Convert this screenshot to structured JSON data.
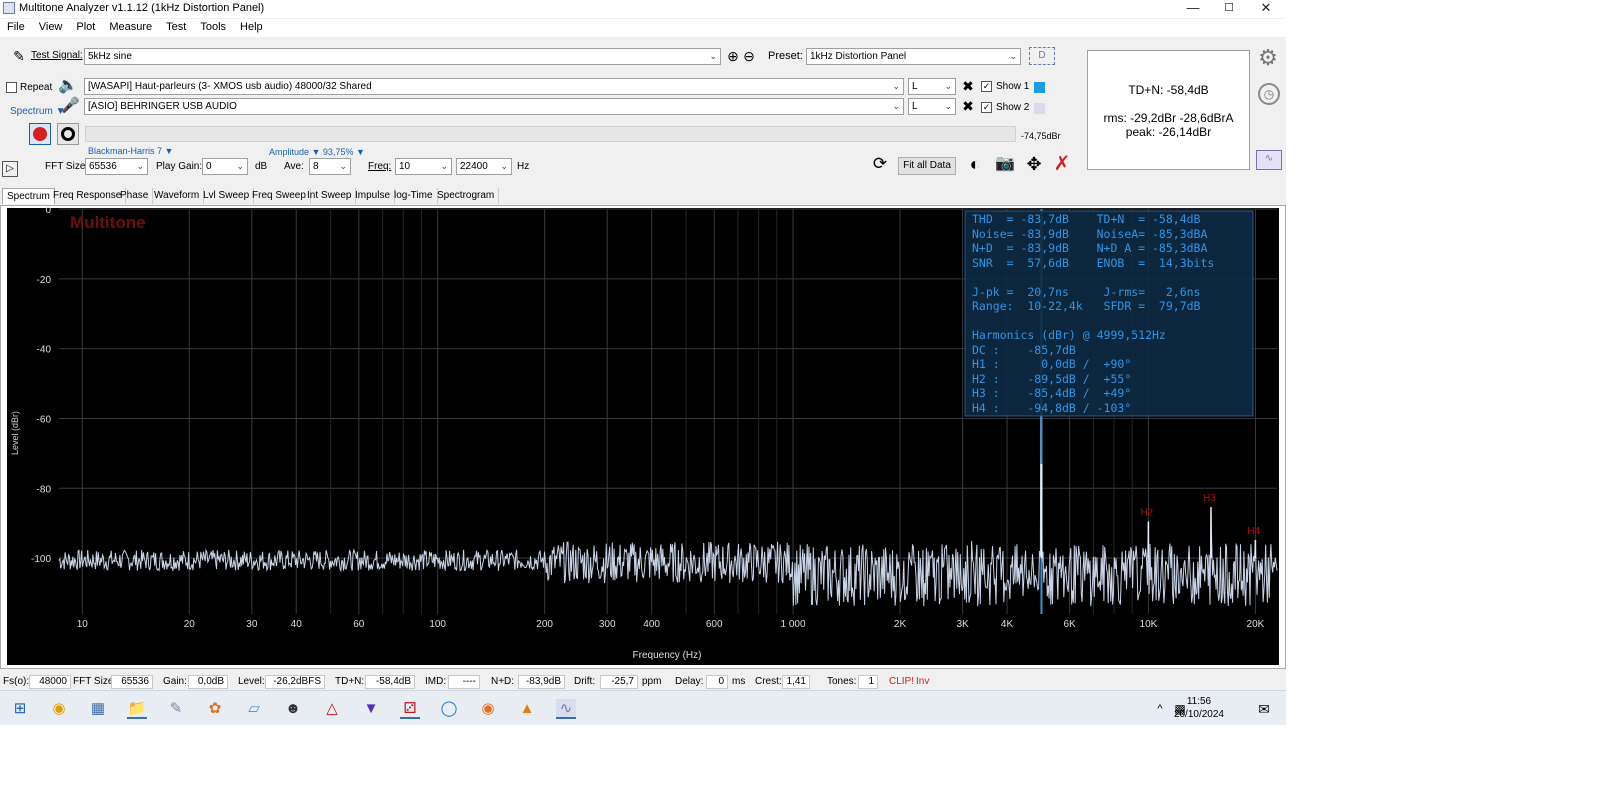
{
  "window": {
    "title": "Multitone Analyzer v1.1.12 (1kHz Distortion Panel)",
    "min": "—",
    "max": "☐",
    "close": "✕"
  },
  "menu": [
    "File",
    "View",
    "Plot",
    "Measure",
    "Test",
    "Tools",
    "Help"
  ],
  "controls": {
    "test_signal_label": "Test Signal:",
    "test_signal_value": "5kHz sine",
    "preset_label": "Preset:",
    "preset_value": "1kHz Distortion Panel",
    "repeat_label": "Repeat",
    "spectrum_label": "Spectrum ▼",
    "out_device": "[WASAPI] Haut-parleurs (3- XMOS usb audio) 48000/32 Shared",
    "in_device": "[ASIO] BEHRINGER USB AUDIO",
    "out_channel": "L",
    "in_channel": "L",
    "show1_label": "Show 1",
    "show2_label": "Show 2",
    "level_readout": "-74,75dBr",
    "window_fn": "Blackman-Harris 7 ▼",
    "amplitude": "Amplitude ▼ 93,75% ▼",
    "fft_label": "FFT Size:",
    "fft_value": "65536",
    "play_gain_label": "Play Gain:",
    "play_gain_value": "0",
    "db_label": "dB",
    "ave_label": "Ave:",
    "ave_value": "8",
    "freq_label": "Freq:",
    "freq_min": "10",
    "freq_max": "22400",
    "hz_label": "Hz",
    "fit_all": "Fit all Data"
  },
  "summary": {
    "tdn": "TD+N: -58,4dB",
    "rms": "rms: -29,2dBr  -28,6dBrA",
    "peak": "peak: -26,14dBr"
  },
  "tabs": [
    "Spectrum",
    "Freq Response",
    "Phase",
    "Waveform",
    "Lvl Sweep",
    "Freq Sweep",
    "Int Sweep",
    "Impulse",
    "log-Time",
    "Spectrogram"
  ],
  "stats": [
    "THD  = -83,7dB    TD+N  = -58,4dB",
    "Noise= -83,9dB    NoiseA= -85,3dBA",
    "N+D  = -83,9dB    N+D A = -85,3dBA",
    "SNR  =  57,6dB    ENOB  =  14,3bits",
    "",
    "J-pk =  20,7ns     J-rms=   2,6ns",
    "Range:  10-22,4k   SFDR =  79,7dB",
    "",
    "Harmonics (dBr) @ 4999,512Hz",
    "DC :    -85,7dB",
    "H1 :      0,0dB /  +90°",
    "H2 :    -89,5dB /  +55°",
    "H3 :    -85,4dB /  +49°",
    "H4 :    -94,8dB / -103°"
  ],
  "chart_data": {
    "type": "line",
    "watermark": "Multitone",
    "xlabel": "Frequency (Hz)",
    "ylabel": "Level (dBr)",
    "xscale": "log",
    "xlim": [
      8.6,
      23000
    ],
    "ylim": [
      -116,
      0
    ],
    "x_ticks": [
      10,
      20,
      30,
      40,
      60,
      100,
      200,
      300,
      400,
      600,
      1000,
      2000,
      3000,
      4000,
      6000,
      10000,
      20000
    ],
    "x_tick_labels": [
      "10",
      "20",
      "30",
      "40",
      "60",
      "100",
      "200",
      "300",
      "400",
      "600",
      "1 000",
      "2K",
      "3K",
      "4K",
      "6K",
      "10K",
      "20K"
    ],
    "y_ticks": [
      0,
      -20,
      -40,
      -60,
      -80,
      -100
    ],
    "y_tick_labels": [
      "0",
      "-20",
      "-40",
      "-60",
      "-80",
      "-100"
    ],
    "noise_floor_db": -100,
    "fundamental": {
      "freq": 5000,
      "level": 0
    },
    "harmonics": [
      {
        "name": "H2",
        "freq": 10000,
        "level": -89.5
      },
      {
        "name": "H3",
        "freq": 15000,
        "level": -85.4
      },
      {
        "name": "H4",
        "freq": 20000,
        "level": -94.8
      }
    ],
    "grid": true,
    "colors": {
      "background": "#000000",
      "trace": "#c8d4e6",
      "cursor": "#3d8fd6",
      "harmonic_label": "#b01010",
      "watermark": "#6b1010"
    }
  },
  "status": {
    "fs_label": "Fs(o):",
    "fs": "48000",
    "fft_label": "FFT Size:",
    "fft": "65536",
    "gain_label": "Gain:",
    "gain": "0,0dB",
    "level_label": "Level:",
    "level": "-26,2dBFS",
    "tdn_label": "TD+N:",
    "tdn": "-58,4dB",
    "imd_label": "IMD:",
    "imd": "----",
    "nd_label": "N+D:",
    "nd": "-83,9dB",
    "drift_label": "Drift:",
    "drift": "-25,7",
    "ppm": "ppm",
    "delay_label": "Delay:",
    "delay": "0",
    "ms": "ms",
    "crest_label": "Crest:",
    "crest": "1,41",
    "tones_label": "Tones:",
    "tones": "1",
    "clip": "CLIP!",
    "inv": "Inv"
  },
  "taskbar": {
    "time": "11:56",
    "date": "20/10/2024"
  }
}
